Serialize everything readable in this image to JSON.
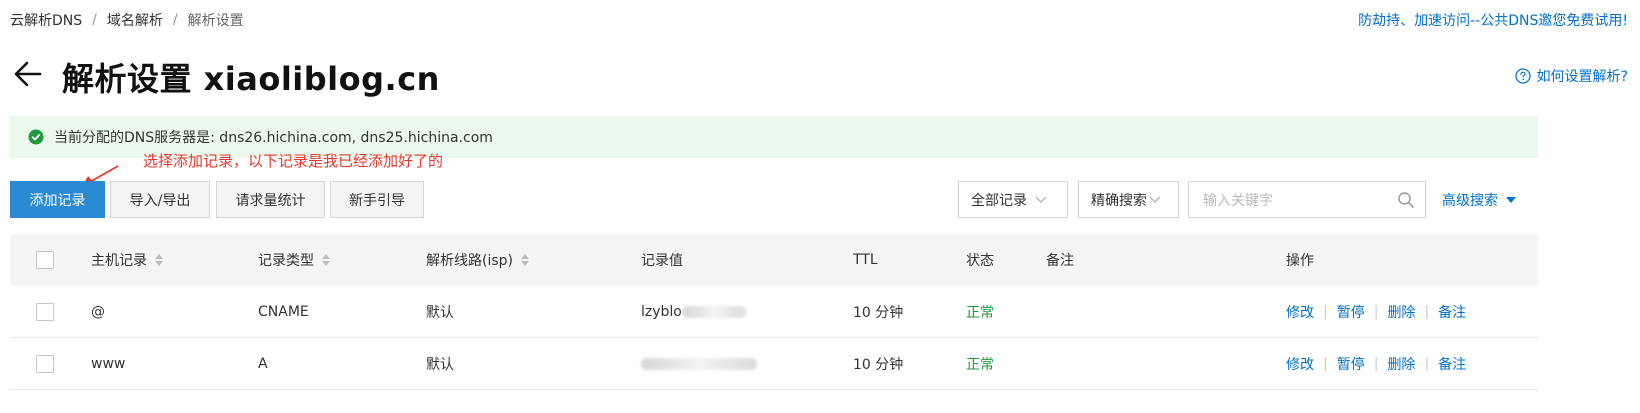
{
  "breadcrumb": {
    "items": [
      "云解析DNS",
      "域名解析",
      "解析设置"
    ],
    "separator": "/"
  },
  "promo_link": "防劫持、加速访问--公共DNS邀您免费试用!",
  "page": {
    "title": "解析设置 xiaoliblog.cn",
    "help_label": "如何设置解析?"
  },
  "info_bar": {
    "text": "当前分配的DNS服务器是: dns26.hichina.com, dns25.hichina.com"
  },
  "annotation": {
    "text": "选择添加记录，以下记录是我已经添加好了的"
  },
  "toolbar": {
    "add_record": "添加记录",
    "import_export": "导入/导出",
    "request_stats": "请求量统计",
    "beginner_guide": "新手引导",
    "filter_select": "全部记录",
    "search_mode": "精确搜索",
    "search_placeholder": "输入关键字",
    "advanced_search": "高级搜索"
  },
  "table": {
    "headers": {
      "host": "主机记录",
      "type": "记录类型",
      "line": "解析线路(isp)",
      "value": "记录值",
      "ttl": "TTL",
      "status": "状态",
      "remark": "备注",
      "actions": "操作"
    },
    "rows": [
      {
        "host": "@",
        "type": "CNAME",
        "line": "默认",
        "value": "lzyblo",
        "ttl": "10 分钟",
        "status": "正常",
        "remark": ""
      },
      {
        "host": "www",
        "type": "A",
        "line": "默认",
        "value": "",
        "ttl": "10 分钟",
        "status": "正常",
        "remark": ""
      }
    ],
    "actions": [
      "修改",
      "暂停",
      "删除",
      "备注"
    ]
  },
  "colors": {
    "link": "#0070cc",
    "primary_button": "#2a8ad4",
    "status_ok": "#1e9a3a",
    "annotation": "#e8372e",
    "info_bg": "#eaf8ee"
  }
}
